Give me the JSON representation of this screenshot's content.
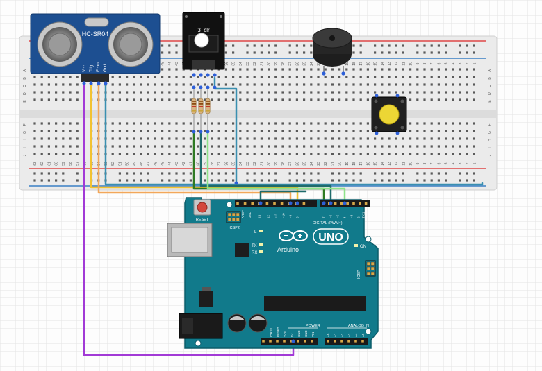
{
  "sensor": {
    "label": "HC-SR04",
    "pins": [
      "Vcc",
      "Trig",
      "Echo",
      "Gnd"
    ]
  },
  "rgb_module": {
    "label": "3_clr"
  },
  "breadboard": {
    "cols_right_to_left": [
      "1",
      "2",
      "3",
      "4",
      "5",
      "6",
      "7",
      "8",
      "9",
      "10",
      "11",
      "12",
      "13",
      "14",
      "15",
      "16",
      "17",
      "18",
      "19",
      "20",
      "21",
      "22",
      "23",
      "24",
      "25",
      "26",
      "27",
      "28",
      "29",
      "30",
      "31",
      "32",
      "33",
      "34",
      "35",
      "36",
      "37",
      "38",
      "39",
      "40",
      "41",
      "42",
      "43",
      "44",
      "45",
      "46",
      "47",
      "48",
      "49",
      "50",
      "51",
      "52",
      "53",
      "54",
      "55",
      "56",
      "57",
      "58",
      "59",
      "60",
      "61",
      "62",
      "63"
    ],
    "rows_top": [
      "A",
      "B",
      "C",
      "D",
      "E"
    ],
    "rows_bottom": [
      "F",
      "G",
      "H",
      "I",
      "J"
    ]
  },
  "arduino": {
    "reset_label": "RESET",
    "icsp2_label": "ICSP2",
    "icsp_label": "ICSP",
    "aref_label": "AREF",
    "gnd_label": "GND",
    "digital_label": "DIGITAL (PWM~)",
    "digital_pins": [
      "13",
      "12",
      "~11",
      "~10",
      "~9",
      "8",
      "7",
      "~6",
      "~5",
      "4",
      "~3",
      "2",
      "TX 1",
      "RX 0"
    ],
    "l_label": "L",
    "tx_label": "TX",
    "rx_label": "RX",
    "on_label": "ON",
    "brand_name": "Arduino",
    "model": "UNO",
    "power_label": "POWER",
    "power_pins": [
      "IOREF",
      "RESET",
      "3V3",
      "5V",
      "GND",
      "GND",
      "VIN"
    ],
    "analog_label": "ANALOG IN",
    "analog_pins": [
      "A0",
      "A1",
      "A2",
      "A3",
      "A4",
      "A5"
    ]
  },
  "wire_colors": {
    "purple": "#a23ad6",
    "yellow": "#f2c230",
    "orange": "#f2a75a",
    "blue": "#3a8fb0",
    "green": "#2e7a23",
    "light_green": "#8ee38a",
    "dark_teal": "#1f6b6b"
  }
}
